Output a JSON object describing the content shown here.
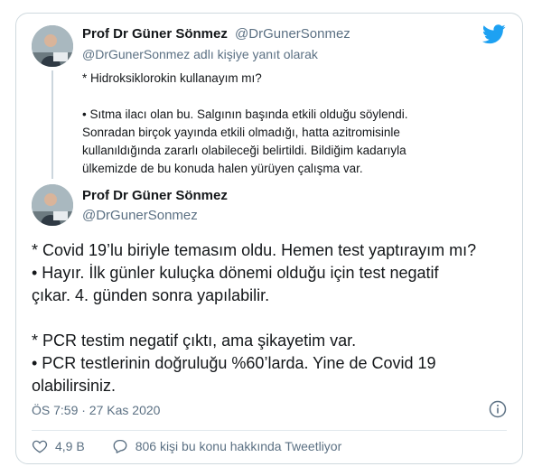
{
  "colors": {
    "brand": "#1da1f2",
    "muted": "#5b7083",
    "text": "#14171a",
    "border": "#cfd9de"
  },
  "parent_tweet": {
    "display_name": "Prof Dr Güner Sönmez",
    "handle": "@DrGunerSonmez",
    "replying_to": "@DrGunerSonmez adlı kişiye yanıt olarak",
    "lines": [
      "* Hidroksiklorokin kullanayım mı?",
      "• Sıtma ilacı olan bu. Salgının başında etkili olduğu söylendi.",
      "Sonradan birçok yayında etkili olmadığı, hatta azitromisinle",
      "kullanıldığında zararlı olabileceği belirtildi. Bildiğim kadarıyla",
      "ülkemizde de bu konuda halen yürüyen çalışma var."
    ]
  },
  "main_tweet": {
    "display_name": "Prof Dr Güner Sönmez",
    "handle": "@DrGunerSonmez",
    "lines": [
      "* Covid 19’lu biriyle temasım oldu. Hemen test yaptırayım mı?",
      "• Hayır. İlk günler kuluçka dönemi olduğu için test negatif",
      "çıkar. 4. günden sonra yapılabilir.",
      "* PCR testim negatif çıktı, ama şikayetim var.",
      "• PCR testlerinin doğruluğu %60’larda. Yine de Covid 19",
      "olabilirsiniz."
    ],
    "timestamp": "ÖS 7:59 · 27 Kas 2020",
    "likes": "4,9 B",
    "conversation": "806 kişi bu konu hakkında Tweetliyor"
  },
  "icons": {
    "logo": "twitter-bird-icon",
    "info": "info-icon",
    "like": "heart-icon",
    "reply": "comment-icon"
  }
}
